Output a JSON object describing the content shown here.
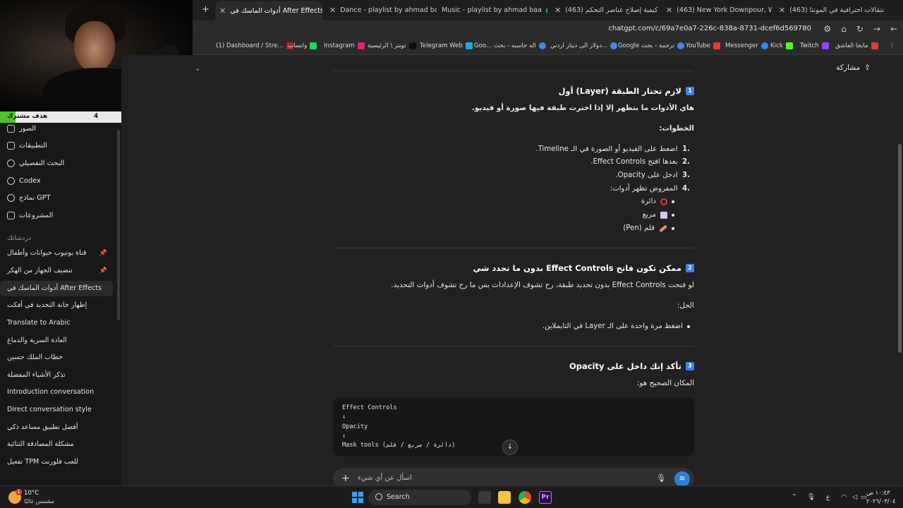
{
  "browser": {
    "tabs": [
      {
        "title": "أدوات الماسك في After Effects",
        "favicon": "gpt",
        "active": true
      },
      {
        "title": "Dance - playlist by ahmad baa",
        "favicon": "sp"
      },
      {
        "title": "Music - playlist by ahmad baa",
        "favicon": "sp"
      },
      {
        "title": "(463) كيفية إصلاح عناصر التحكم",
        "favicon": "yt"
      },
      {
        "title": "(463) New York Downpour, Wa",
        "favicon": "yt"
      },
      {
        "title": "(463) انتقالات احترافية في المونتا",
        "favicon": "yt"
      }
    ],
    "url": "chatgpt.com/c/69a7e0a7-226c-838a-8731-dcef6d569780",
    "bookmarks": [
      {
        "label": "(1) Dashboard / Stre...",
        "color": "#b22222"
      },
      {
        "label": "واتساب",
        "color": "#25d366"
      },
      {
        "label": "Instagram",
        "color": "#d62976"
      },
      {
        "label": "تويتر \\ الرئيسية",
        "color": "#111111"
      },
      {
        "label": "Telegram Web",
        "color": "#2aa3e0"
      },
      {
        "label": "Goo... اله حاسبه - بحث",
        "color": "#4285f4"
      },
      {
        "label": "دولار الى دينار اردني...",
        "color": "#4285f4"
      },
      {
        "label": "Google ترجمة - بحث",
        "color": "#4285f4"
      },
      {
        "label": "YouTube",
        "color": "#e53935"
      },
      {
        "label": "Messenger",
        "color": "#1e90ff"
      },
      {
        "label": "Kick",
        "color": "#53fc18"
      },
      {
        "label": "Twitch",
        "color": "#9146ff"
      },
      {
        "label": "مانجا العاشق",
        "color": "#e53935"
      }
    ]
  },
  "stream_goal": {
    "label": "هدف مشترك",
    "current": "4",
    "max": "50",
    "progress": 0.08
  },
  "sidebar": {
    "nav": [
      {
        "label": "الصور",
        "icon": "images-icon"
      },
      {
        "label": "التطبيقات",
        "icon": "apps-icon"
      },
      {
        "label": "البحث التفصيلي",
        "icon": "deep-research-icon"
      },
      {
        "label": "Codex",
        "icon": "codex-icon"
      },
      {
        "label": "نماذج GPT",
        "icon": "gpts-icon"
      },
      {
        "label": "المشروعات",
        "icon": "projects-icon"
      }
    ],
    "section_title": "دردشاتك",
    "chats": [
      {
        "label": "قناة يوتيوب حيوانات وأطفال",
        "pinned": true
      },
      {
        "label": "تنضيف الجهاز من الهكر",
        "pinned": true
      },
      {
        "label": "أدوات الماسك في After Effects",
        "active": true
      },
      {
        "label": "إظهار خانة التحديد في أفكت"
      },
      {
        "label": "Translate to Arabic"
      },
      {
        "label": "العادة السرية والدماغ"
      },
      {
        "label": "خطاب الملك حسين"
      },
      {
        "label": "تذكر الأشياء المفضلة"
      },
      {
        "label": "Introduction conversation"
      },
      {
        "label": "Direct conversation style"
      },
      {
        "label": "أفضل تطبيق مساعد ذكي"
      },
      {
        "label": "مشكلة المصادقة الثنائية"
      },
      {
        "label": "تفعيل TPM للعب فلورنت"
      }
    ]
  },
  "header": {
    "share_label": "مشاركة"
  },
  "message": {
    "s1": {
      "num": "1",
      "title": "لازم تختار الطبقة (Layer) أول",
      "intro": "هاي الأدوات ما بتظهر إلا إذا اخترت طبقة فيها صورة أو فيديو.",
      "steps_label": "الخطوات:",
      "steps": [
        "اضغط على الفيديو أو الصورة في الـ Timeline.",
        "بعدها افتح Effect Controls.",
        "ادخل على Opacity.",
        "المفروض تظهر أدوات:"
      ],
      "tools": [
        "دائرة",
        "مربع",
        "قلم (Pen)"
      ]
    },
    "s2": {
      "num": "2",
      "title": "ممكن تكون فاتح Effect Controls بدون ما تحدد شي",
      "body": "لو فتحت Effect Controls بدون تحديد طبقة، رح تشوف الإعدادات بس ما رح تشوف أدوات التحديد.",
      "solution_label": "الحل:",
      "solution_item": "اضغط مرة واحدة على الـ Layer في التايملاين."
    },
    "s3": {
      "num": "3",
      "title": "تأكد إنك داخل على Opacity",
      "body": "المكان الصحيح هو:"
    },
    "code": [
      "Effect Controls",
      "     ↓",
      "Opacity",
      "     ↓",
      "Mask tools (دائرة / مربع / قلم)"
    ]
  },
  "composer": {
    "placeholder": "اسأل عن أي شيء"
  },
  "taskbar": {
    "weather_temp": "10°C",
    "weather_desc": "مشمس غالبًا",
    "weather_badge": "1",
    "search_label": "Search",
    "lang": "ع",
    "time": "١٠:٤٣ ص",
    "date": "٢٠٢٦/٠٣/٠٤"
  }
}
